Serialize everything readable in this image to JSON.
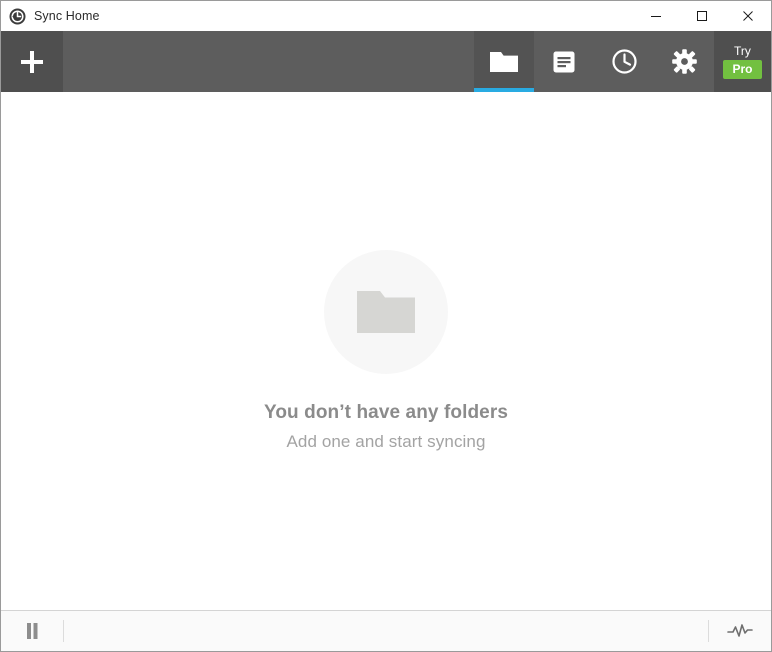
{
  "window": {
    "title": "Sync Home",
    "app_icon": "sync-circle-icon",
    "controls": [
      {
        "name": "minimize",
        "icon": "minimize-icon"
      },
      {
        "name": "maximize",
        "icon": "maximize-icon"
      },
      {
        "name": "close",
        "icon": "close-icon"
      }
    ]
  },
  "toolbar": {
    "add_button": {
      "label": "+",
      "icon": "plus-icon"
    },
    "tabs": [
      {
        "name": "folders",
        "icon": "folder-icon",
        "active": true
      },
      {
        "name": "devices",
        "icon": "list-document-icon",
        "active": false
      },
      {
        "name": "history",
        "icon": "clock-icon",
        "active": false
      },
      {
        "name": "settings",
        "icon": "gear-icon",
        "active": false
      }
    ],
    "try_pro": {
      "try_label": "Try",
      "pro_label": "Pro"
    }
  },
  "empty_state": {
    "illustration_icon": "folder-illustration-icon",
    "title": "You don’t have any folders",
    "subtitle": "Add one and start syncing"
  },
  "statusbar": {
    "pause_button": {
      "icon": "pause-icon"
    },
    "activity_button": {
      "icon": "activity-pulse-icon"
    }
  },
  "colors": {
    "toolbar_bg": "#5d5d5d",
    "toolbar_panel_bg": "#4f4f4f",
    "active_tab_bg": "#535353",
    "accent_underline": "#29abe2",
    "pro_badge_green": "#72c040",
    "empty_circle": "#f7f7f7",
    "empty_folder": "#d6d6d3",
    "title_text": "#2b2b2b",
    "empty_title_text": "#8b8b8b",
    "empty_subtitle_text": "#a3a3a3",
    "statusbar_bg": "#fafafa"
  }
}
